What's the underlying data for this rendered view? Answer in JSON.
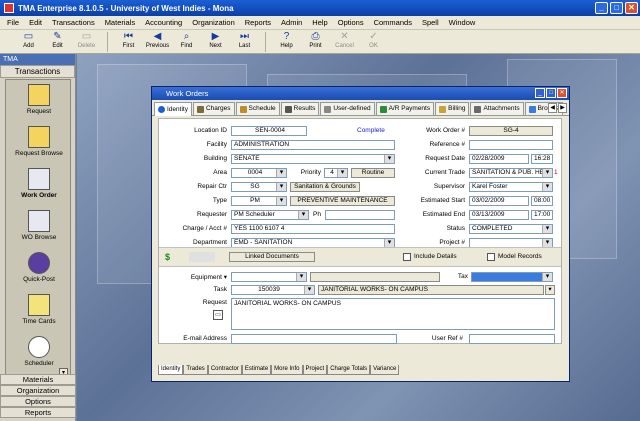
{
  "window": {
    "title": "TMA Enterprise 8.1.0.5 - University of West Indies - Mona"
  },
  "menu": [
    "File",
    "Edit",
    "Transactions",
    "Materials",
    "Accounting",
    "Organization",
    "Reports",
    "Admin",
    "Help",
    "Options",
    "Commands",
    "Spell",
    "Window"
  ],
  "toolbar": {
    "add": "Add",
    "edit": "Edit",
    "delete": "Delete",
    "first": "First",
    "previous": "Previous",
    "find": "Find",
    "next": "Next",
    "last": "Last",
    "help": "Help",
    "print": "Print",
    "cancel": "Cancel",
    "ok": "OK"
  },
  "leftnav": {
    "title": "TMA",
    "section": "Transactions",
    "items": [
      {
        "label": "Request"
      },
      {
        "label": "Request Browse"
      },
      {
        "label": "Work Order"
      },
      {
        "label": "WO Browse"
      },
      {
        "label": "Quick-Post"
      },
      {
        "label": "Time Cards"
      },
      {
        "label": "Scheduler"
      }
    ],
    "bottom": [
      "Materials",
      "Organization",
      "Options",
      "Reports"
    ]
  },
  "workorder": {
    "title": "Work Orders",
    "tabs": [
      "Identity",
      "Charges",
      "Schedule",
      "Results",
      "User-defined",
      "A/R Payments",
      "Billing",
      "Attachments",
      "Browse"
    ],
    "labels": {
      "location_id": "Location ID",
      "facility": "Facility",
      "building": "Building",
      "area": "Area",
      "priority": "Priority",
      "repair_ctr": "Repair Ctr",
      "type": "Type",
      "requester": "Requester",
      "ph": "Ph",
      "charge": "Charge / Acct #",
      "department": "Department",
      "work_order": "Work Order #",
      "reference": "Reference #",
      "request_date": "Request Date",
      "current_trade": "Current Trade",
      "supervisor": "Supervisor",
      "est_start": "Estimated Start",
      "est_end": "Estimated End",
      "status": "Status",
      "project": "Project #",
      "equipment": "Equipment",
      "tax": "Tax",
      "task": "Task",
      "request": "Request",
      "email": "E-mail Address",
      "user_ref": "User Ref #"
    },
    "values": {
      "location_id": "SEN-0004",
      "complete": "Complete",
      "facility": "ADMINISTRATION",
      "building": "SENATE",
      "area": "0004",
      "priority": "4",
      "priority_desc": "Routine",
      "repair_ctr": "SG",
      "repair_ctr_desc": "Sanitation & Grounds",
      "type": "PM",
      "type_desc": "PREVENTIVE MAINTENANCE",
      "requester": "PM Scheduler",
      "ph": "",
      "charge_flag": "YES",
      "charge": "1100 6107 4",
      "department": "EMD - SANITATION",
      "work_order": "SG-4",
      "reference": "",
      "request_date": "02/28/2009",
      "request_time": "16:28",
      "current_trade": "SANITATION & PUB. HE",
      "trade_count": "1",
      "supervisor": "Karel Foster",
      "est_start_date": "03/02/2009",
      "est_start_time": "08:00",
      "est_end_date": "03/13/2009",
      "est_end_time": "17:00",
      "status": "COMPLETED",
      "project": "",
      "equipment": "",
      "tax": "",
      "task": "150039",
      "task_desc": "JANITORIAL WORKS- ON CAMPUS",
      "request_text": "JANITORIAL WORKS- ON CAMPUS",
      "email": "",
      "user_ref": ""
    },
    "linked_docs": "Linked Documents",
    "include_details": "Include Details",
    "model_records": "Model Records",
    "bottom_tabs": [
      "Identity",
      "Trades",
      "Contractor",
      "Estimate",
      "More Info",
      "Project",
      "Charge Totals",
      "Variance"
    ]
  },
  "colors": {
    "accent": "#1c5fd4",
    "tax_field": "#3a7be0"
  }
}
